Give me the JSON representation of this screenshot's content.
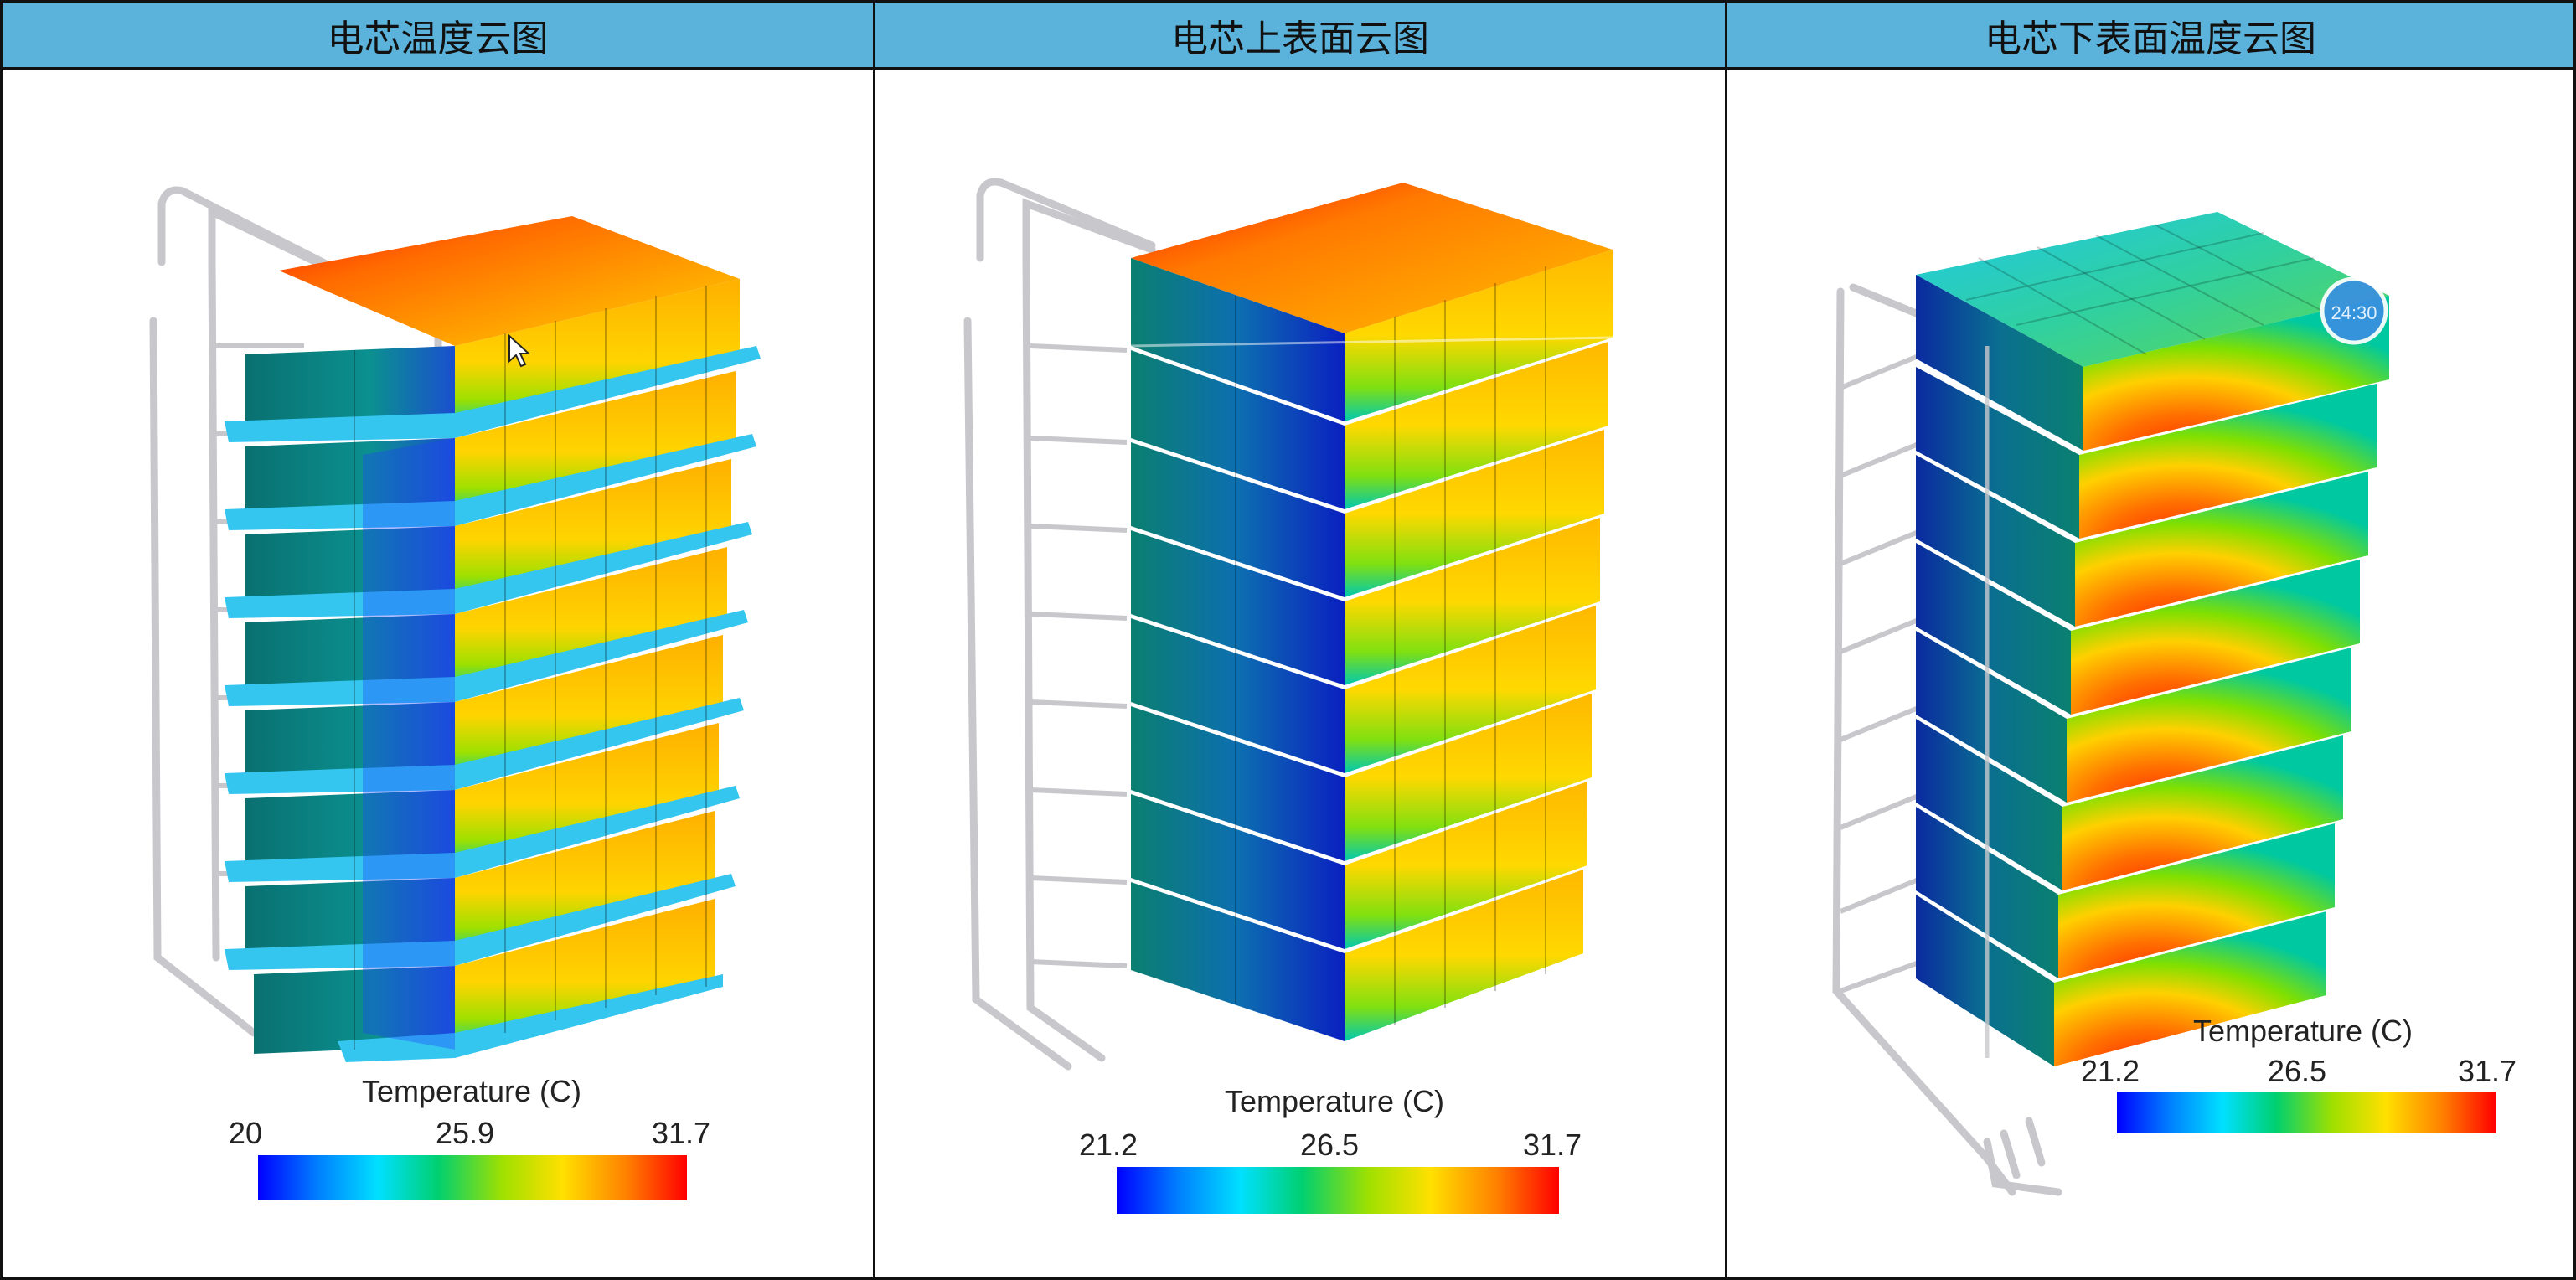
{
  "panels": [
    {
      "title": "电芯温度云图",
      "legend": {
        "title": "Temperature (C)",
        "min": "20",
        "mid": "25.9",
        "max": "31.7"
      }
    },
    {
      "title": "电芯上表面云图",
      "legend": {
        "title": "Temperature (C)",
        "min": "21.2",
        "mid": "26.5",
        "max": "31.7"
      }
    },
    {
      "title": "电芯下表面温度云图",
      "legend": {
        "title": "Temperature (C)",
        "min": "21.2",
        "mid": "26.5",
        "max": "31.7"
      },
      "overlay_time": "24:30"
    }
  ],
  "colors": {
    "header_bg": "#5bb3dc",
    "colormap": [
      "#0000ff",
      "#0080ff",
      "#00e0ff",
      "#00d070",
      "#a0e000",
      "#ffe000",
      "#ff8000",
      "#ff0000"
    ]
  },
  "icons": {
    "cursor": "mouse-pointer-icon",
    "timer": "timer-badge-icon"
  }
}
